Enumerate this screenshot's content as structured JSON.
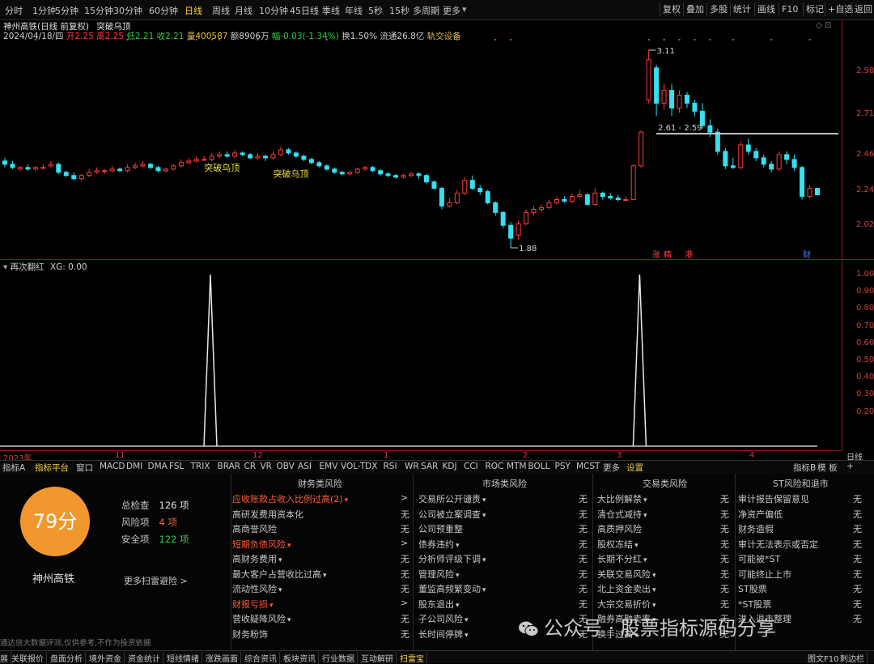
{
  "toolbar": {
    "periods": [
      "分时",
      "1分钟",
      "5分钟",
      "15分钟",
      "30分钟",
      "60分钟",
      "日线",
      "周线",
      "月线",
      "10分钟",
      "45日线",
      "季线",
      "年线",
      "5秒",
      "15秒",
      "多周期",
      "更多"
    ],
    "active_period": "日线",
    "right_buttons": [
      "复权",
      "叠加",
      "多股",
      "统计",
      "画线",
      "F10",
      "标记",
      "+自选",
      "返回"
    ]
  },
  "stock": {
    "title": "神州高铁(日线 前复权)",
    "pattern_name": "突破乌顶",
    "date": "2024/04/18/四",
    "open": "开2.25",
    "high": "高2.25",
    "low": "低2.21",
    "close": "收2.21",
    "volume": "量400587",
    "amount": "额8906万",
    "change": "幅-0.03(-1.34%)",
    "turnover": "换1.50%",
    "float_cap": "流通26.8亿",
    "concept": "轨交设备"
  },
  "chart_data": {
    "type": "candlestick",
    "ylim": [
      1.88,
      3.11
    ],
    "price_ticks": [
      "2.98",
      "2.71",
      "2.46",
      "2.24",
      "2.02"
    ],
    "annotations": {
      "high_label": "3.11",
      "low_label": "1.88",
      "range_label": "2.61 - 2.59",
      "signal_label": "突破乌顶"
    },
    "event_markers": [
      "涨",
      "精",
      "港",
      "财"
    ],
    "candles": [
      {
        "o": 2.42,
        "c": 2.4,
        "h": 2.44,
        "l": 2.38
      },
      {
        "o": 2.4,
        "c": 2.38,
        "h": 2.42,
        "l": 2.37
      },
      {
        "o": 2.37,
        "c": 2.38,
        "h": 2.39,
        "l": 2.36
      },
      {
        "o": 2.38,
        "c": 2.37,
        "h": 2.4,
        "l": 2.36
      },
      {
        "o": 2.37,
        "c": 2.38,
        "h": 2.39,
        "l": 2.36
      },
      {
        "o": 2.38,
        "c": 2.38,
        "h": 2.4,
        "l": 2.37
      },
      {
        "o": 2.39,
        "c": 2.4,
        "h": 2.42,
        "l": 2.38
      },
      {
        "o": 2.4,
        "c": 2.35,
        "h": 2.41,
        "l": 2.34
      },
      {
        "o": 2.35,
        "c": 2.33,
        "h": 2.36,
        "l": 2.32
      },
      {
        "o": 2.33,
        "c": 2.31,
        "h": 2.35,
        "l": 2.3
      },
      {
        "o": 2.31,
        "c": 2.33,
        "h": 2.34,
        "l": 2.3
      },
      {
        "o": 2.33,
        "c": 2.35,
        "h": 2.37,
        "l": 2.32
      },
      {
        "o": 2.35,
        "c": 2.36,
        "h": 2.38,
        "l": 2.34
      },
      {
        "o": 2.36,
        "c": 2.36,
        "h": 2.37,
        "l": 2.34
      },
      {
        "o": 2.36,
        "c": 2.37,
        "h": 2.39,
        "l": 2.35
      },
      {
        "o": 2.37,
        "c": 2.36,
        "h": 2.38,
        "l": 2.35
      },
      {
        "o": 2.36,
        "c": 2.38,
        "h": 2.4,
        "l": 2.35
      },
      {
        "o": 2.38,
        "c": 2.39,
        "h": 2.41,
        "l": 2.37
      },
      {
        "o": 2.39,
        "c": 2.4,
        "h": 2.42,
        "l": 2.38
      },
      {
        "o": 2.4,
        "c": 2.38,
        "h": 2.41,
        "l": 2.37
      },
      {
        "o": 2.38,
        "c": 2.36,
        "h": 2.39,
        "l": 2.35
      },
      {
        "o": 2.36,
        "c": 2.37,
        "h": 2.38,
        "l": 2.35
      },
      {
        "o": 2.37,
        "c": 2.39,
        "h": 2.4,
        "l": 2.36
      },
      {
        "o": 2.39,
        "c": 2.41,
        "h": 2.43,
        "l": 2.38
      },
      {
        "o": 2.41,
        "c": 2.42,
        "h": 2.44,
        "l": 2.4
      },
      {
        "o": 2.42,
        "c": 2.43,
        "h": 2.45,
        "l": 2.41
      },
      {
        "o": 2.43,
        "c": 2.43,
        "h": 2.45,
        "l": 2.42
      },
      {
        "o": 2.43,
        "c": 2.45,
        "h": 2.47,
        "l": 2.42
      },
      {
        "o": 2.45,
        "c": 2.46,
        "h": 2.48,
        "l": 2.44
      },
      {
        "o": 2.46,
        "c": 2.45,
        "h": 2.48,
        "l": 2.44
      },
      {
        "o": 2.45,
        "c": 2.47,
        "h": 2.49,
        "l": 2.44
      },
      {
        "o": 2.47,
        "c": 2.46,
        "h": 2.48,
        "l": 2.45
      },
      {
        "o": 2.46,
        "c": 2.44,
        "h": 2.47,
        "l": 2.43
      },
      {
        "o": 2.44,
        "c": 2.45,
        "h": 2.47,
        "l": 2.43
      },
      {
        "o": 2.45,
        "c": 2.44,
        "h": 2.46,
        "l": 2.42
      },
      {
        "o": 2.44,
        "c": 2.46,
        "h": 2.48,
        "l": 2.43
      },
      {
        "o": 2.46,
        "c": 2.49,
        "h": 2.51,
        "l": 2.45
      },
      {
        "o": 2.49,
        "c": 2.47,
        "h": 2.5,
        "l": 2.46
      },
      {
        "o": 2.47,
        "c": 2.45,
        "h": 2.48,
        "l": 2.44
      },
      {
        "o": 2.45,
        "c": 2.43,
        "h": 2.46,
        "l": 2.42
      },
      {
        "o": 2.43,
        "c": 2.41,
        "h": 2.44,
        "l": 2.4
      },
      {
        "o": 2.41,
        "c": 2.39,
        "h": 2.42,
        "l": 2.38
      },
      {
        "o": 2.39,
        "c": 2.37,
        "h": 2.4,
        "l": 2.36
      },
      {
        "o": 2.37,
        "c": 2.35,
        "h": 2.38,
        "l": 2.34
      },
      {
        "o": 2.35,
        "c": 2.34,
        "h": 2.36,
        "l": 2.33
      },
      {
        "o": 2.34,
        "c": 2.35,
        "h": 2.36,
        "l": 2.33
      },
      {
        "o": 2.35,
        "c": 2.37,
        "h": 2.38,
        "l": 2.34
      },
      {
        "o": 2.37,
        "c": 2.38,
        "h": 2.39,
        "l": 2.36
      },
      {
        "o": 2.38,
        "c": 2.36,
        "h": 2.39,
        "l": 2.35
      },
      {
        "o": 2.36,
        "c": 2.34,
        "h": 2.37,
        "l": 2.33
      },
      {
        "o": 2.34,
        "c": 2.33,
        "h": 2.35,
        "l": 2.32
      },
      {
        "o": 2.33,
        "c": 2.32,
        "h": 2.34,
        "l": 2.31
      },
      {
        "o": 2.32,
        "c": 2.33,
        "h": 2.34,
        "l": 2.31
      },
      {
        "o": 2.33,
        "c": 2.34,
        "h": 2.35,
        "l": 2.32
      },
      {
        "o": 2.34,
        "c": 2.33,
        "h": 2.35,
        "l": 2.31
      },
      {
        "o": 2.33,
        "c": 2.29,
        "h": 2.34,
        "l": 2.28
      },
      {
        "o": 2.29,
        "c": 2.25,
        "h": 2.3,
        "l": 2.24
      },
      {
        "o": 2.25,
        "c": 2.14,
        "h": 2.26,
        "l": 2.12
      },
      {
        "o": 2.14,
        "c": 2.16,
        "h": 2.19,
        "l": 2.13
      },
      {
        "o": 2.16,
        "c": 2.22,
        "h": 2.24,
        "l": 2.15
      },
      {
        "o": 2.22,
        "c": 2.3,
        "h": 2.32,
        "l": 2.21
      },
      {
        "o": 2.3,
        "c": 2.25,
        "h": 2.33,
        "l": 2.24
      },
      {
        "o": 2.25,
        "c": 2.23,
        "h": 2.27,
        "l": 2.21
      },
      {
        "o": 2.23,
        "c": 2.16,
        "h": 2.24,
        "l": 2.15
      },
      {
        "o": 2.16,
        "c": 2.1,
        "h": 2.17,
        "l": 2.08
      },
      {
        "o": 2.1,
        "c": 2.02,
        "h": 2.11,
        "l": 2.0
      },
      {
        "o": 2.02,
        "c": 1.94,
        "h": 2.04,
        "l": 1.88
      },
      {
        "o": 1.96,
        "c": 2.03,
        "h": 2.05,
        "l": 1.93
      },
      {
        "o": 2.03,
        "c": 2.1,
        "h": 2.12,
        "l": 2.02
      },
      {
        "o": 2.1,
        "c": 2.12,
        "h": 2.14,
        "l": 2.08
      },
      {
        "o": 2.12,
        "c": 2.13,
        "h": 2.15,
        "l": 2.1
      },
      {
        "o": 2.13,
        "c": 2.16,
        "h": 2.18,
        "l": 2.12
      },
      {
        "o": 2.16,
        "c": 2.18,
        "h": 2.2,
        "l": 2.15
      },
      {
        "o": 2.18,
        "c": 2.17,
        "h": 2.2,
        "l": 2.16
      },
      {
        "o": 2.17,
        "c": 2.2,
        "h": 2.22,
        "l": 2.16
      },
      {
        "o": 2.2,
        "c": 2.21,
        "h": 2.24,
        "l": 2.19
      },
      {
        "o": 2.21,
        "c": 2.15,
        "h": 2.22,
        "l": 2.14
      },
      {
        "o": 2.15,
        "c": 2.22,
        "h": 2.25,
        "l": 2.14
      },
      {
        "o": 2.22,
        "c": 2.2,
        "h": 2.23,
        "l": 2.18
      },
      {
        "o": 2.2,
        "c": 2.19,
        "h": 2.22,
        "l": 2.18
      },
      {
        "o": 2.19,
        "c": 2.18,
        "h": 2.21,
        "l": 2.17
      },
      {
        "o": 2.18,
        "c": 2.18,
        "h": 2.2,
        "l": 2.17
      },
      {
        "o": 2.18,
        "c": 2.39,
        "h": 2.4,
        "l": 2.18
      },
      {
        "o": 2.39,
        "c": 2.6,
        "h": 2.61,
        "l": 2.38
      },
      {
        "o": 2.8,
        "c": 3.05,
        "h": 3.11,
        "l": 2.78
      },
      {
        "o": 3.0,
        "c": 2.78,
        "h": 3.02,
        "l": 2.7
      },
      {
        "o": 2.78,
        "c": 2.86,
        "h": 2.9,
        "l": 2.74
      },
      {
        "o": 2.86,
        "c": 2.75,
        "h": 2.9,
        "l": 2.7
      },
      {
        "o": 2.75,
        "c": 2.83,
        "h": 2.86,
        "l": 2.72
      },
      {
        "o": 2.83,
        "c": 2.78,
        "h": 2.85,
        "l": 2.75
      },
      {
        "o": 2.78,
        "c": 2.73,
        "h": 2.8,
        "l": 2.7
      },
      {
        "o": 2.73,
        "c": 2.64,
        "h": 2.78,
        "l": 2.62
      },
      {
        "o": 2.64,
        "c": 2.6,
        "h": 2.68,
        "l": 2.57
      },
      {
        "o": 2.6,
        "c": 2.48,
        "h": 2.62,
        "l": 2.46
      },
      {
        "o": 2.48,
        "c": 2.39,
        "h": 2.5,
        "l": 2.37
      },
      {
        "o": 2.39,
        "c": 2.38,
        "h": 2.44,
        "l": 2.37
      },
      {
        "o": 2.38,
        "c": 2.52,
        "h": 2.54,
        "l": 2.37
      },
      {
        "o": 2.52,
        "c": 2.48,
        "h": 2.56,
        "l": 2.46
      },
      {
        "o": 2.48,
        "c": 2.44,
        "h": 2.5,
        "l": 2.42
      },
      {
        "o": 2.44,
        "c": 2.4,
        "h": 2.46,
        "l": 2.38
      },
      {
        "o": 2.4,
        "c": 2.37,
        "h": 2.42,
        "l": 2.35
      },
      {
        "o": 2.37,
        "c": 2.46,
        "h": 2.48,
        "l": 2.36
      },
      {
        "o": 2.46,
        "c": 2.43,
        "h": 2.48,
        "l": 2.4
      },
      {
        "o": 2.43,
        "c": 2.38,
        "h": 2.46,
        "l": 2.36
      },
      {
        "o": 2.38,
        "c": 2.2,
        "h": 2.39,
        "l": 2.18
      },
      {
        "o": 2.2,
        "c": 2.25,
        "h": 2.27,
        "l": 2.19
      },
      {
        "o": 2.25,
        "c": 2.21,
        "h": 2.25,
        "l": 2.21
      }
    ],
    "flat_line": 2.59
  },
  "indicator": {
    "name": "再次翻红",
    "value_label": "XG: 0.00",
    "ticks": [
      "1.00",
      "0.90",
      "0.80",
      "0.70",
      "0.60",
      "0.50",
      "0.40",
      "0.30",
      "0.20"
    ],
    "signals": [
      0.25,
      0.76
    ]
  },
  "time_axis": {
    "labels": [
      "2023年",
      "11",
      "12",
      "1",
      "2",
      "3",
      "4"
    ],
    "right_label": "日线"
  },
  "indicator_tabs": [
    "指标A",
    "指标平台",
    "窗口",
    "MACD",
    "DMI",
    "DMA",
    "FSL",
    "TRIX",
    "BRAR",
    "CR",
    "VR",
    "OBV",
    "ASI",
    "EMV",
    "VOL-TDX",
    "RSI",
    "WR",
    "SAR",
    "KDJ",
    "CCI",
    "ROC",
    "MTM",
    "BOLL",
    "PSY",
    "MCST",
    "更多",
    "设置"
  ],
  "indicator_tabs_right": [
    "指标B",
    "模",
    "板",
    "+"
  ],
  "risk": {
    "score": "79分",
    "stock_name": "神州高铁",
    "summary": [
      {
        "label": "总检查",
        "value": "126 项"
      },
      {
        "label": "风险项",
        "value": "4 项"
      },
      {
        "label": "安全项",
        "value": "122 项"
      }
    ],
    "more_link": "更多扫雷避险 >",
    "disclaimer": "通达信大数据评测,仅供参考,不作为投资依据",
    "columns": [
      {
        "title": "财务类风险",
        "rows": [
          {
            "label": "应收账款占收入比例过高(2)",
            "value": ">",
            "risk": true
          },
          {
            "label": "高研发费用资本化",
            "value": "无",
            "risk": false
          },
          {
            "label": "高商誉风险",
            "value": "无",
            "risk": false
          },
          {
            "label": "短期负债风险",
            "value": ">",
            "risk": true
          },
          {
            "label": "高财务费用",
            "value": "无",
            "risk": false
          },
          {
            "label": "最大客户占营收比过高",
            "value": "无",
            "risk": false
          },
          {
            "label": "流动性风险",
            "value": "无",
            "risk": false
          },
          {
            "label": "财报亏损",
            "value": ">",
            "risk": true
          },
          {
            "label": "营收疑降风险",
            "value": "无",
            "risk": false
          },
          {
            "label": "财务粉饰",
            "value": "无",
            "risk": false
          }
        ]
      },
      {
        "title": "市场类风险",
        "rows": [
          {
            "label": "交易所公开谴责",
            "value": "无",
            "risk": false
          },
          {
            "label": "公司被立案调查",
            "value": "无",
            "risk": false
          },
          {
            "label": "公司预重整",
            "value": "无",
            "risk": false
          },
          {
            "label": "债券违约",
            "value": "无",
            "risk": false
          },
          {
            "label": "分析师评级下调",
            "value": "无",
            "risk": false
          },
          {
            "label": "管理风险",
            "value": "无",
            "risk": false
          },
          {
            "label": "董监高频繁变动",
            "value": "无",
            "risk": false
          },
          {
            "label": "股东退出",
            "value": "无",
            "risk": false
          },
          {
            "label": "子公司风险",
            "value": "无",
            "risk": false
          },
          {
            "label": "长时间停牌",
            "value": "无",
            "risk": false
          }
        ]
      },
      {
        "title": "交易类风险",
        "rows": [
          {
            "label": "大比例解禁",
            "value": "无",
            "risk": false
          },
          {
            "label": "清仓式减持",
            "value": "无",
            "risk": false
          },
          {
            "label": "高质押风险",
            "value": "无",
            "risk": false
          },
          {
            "label": "股权冻结",
            "value": "无",
            "risk": false
          },
          {
            "label": "长期不分红",
            "value": "无",
            "risk": false
          },
          {
            "label": "关联交易风险",
            "value": "无",
            "risk": false
          },
          {
            "label": "北上资金卖出",
            "value": "无",
            "risk": false
          },
          {
            "label": "大宗交易折价",
            "value": "无",
            "risk": false
          },
          {
            "label": "融券高融卖率",
            "value": "无",
            "risk": false
          },
          {
            "label": "换手过高",
            "value": "无",
            "risk": false
          }
        ]
      },
      {
        "title": "ST风险和退市",
        "rows": [
          {
            "label": "审计报告保留意见",
            "value": "无",
            "risk": false
          },
          {
            "label": "净资产偏低",
            "value": "无",
            "risk": false
          },
          {
            "label": "财务造假",
            "value": "无",
            "risk": false
          },
          {
            "label": "审计无法表示或否定",
            "value": "无",
            "risk": false
          },
          {
            "label": "可能被*ST",
            "value": "无",
            "risk": false
          },
          {
            "label": "可能终止上市",
            "value": "无",
            "risk": false
          },
          {
            "label": "ST股票",
            "value": "无",
            "risk": false
          },
          {
            "label": "*ST股票",
            "value": "无",
            "risk": false
          },
          {
            "label": "进入退市整理",
            "value": "无",
            "risk": false
          }
        ]
      }
    ]
  },
  "bottom_bar": [
    "展",
    "关联报价",
    "盘面分析",
    "境外资金",
    "资金统计",
    "短线情绪",
    "涨跌画面",
    "综合资讯",
    "板块资讯",
    "行业数据",
    "互动解研",
    "扫雷宝"
  ],
  "bottom_right": [
    "图文F10",
    "刺边栏"
  ],
  "watermark": "公众号 · 股票指标源码分享",
  "colors": {
    "up": "#ff3b3b",
    "down": "#35e0f0",
    "axis": "#d04040",
    "risk": "#ff5a3a",
    "score": "#f0982e"
  }
}
